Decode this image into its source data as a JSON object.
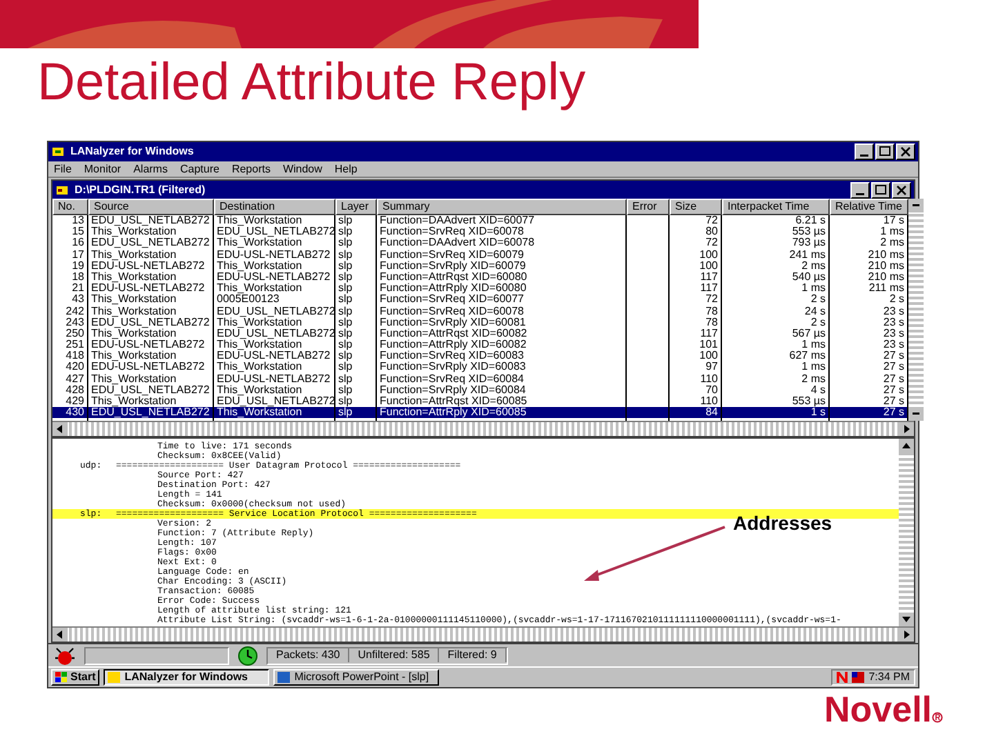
{
  "slide": {
    "title": "Detailed Attribute Reply",
    "logo": "Novell",
    "annotation": "Addresses"
  },
  "window": {
    "title": "LANalyzer for Windows"
  },
  "menu": [
    "File",
    "Monitor",
    "Alarms",
    "Capture",
    "Reports",
    "Window",
    "Help"
  ],
  "child_window": {
    "title": "D:\\PLDGIN.TR1 (Filtered)"
  },
  "table": {
    "columns": [
      "No.",
      "Source",
      "Destination",
      "Layer",
      "Summary",
      "Error",
      "Size",
      "Interpacket Time",
      "Relative Time"
    ],
    "rows": [
      {
        "selected": false,
        "cells": [
          "13",
          "EDU_USL_NETLAB272",
          "This_Workstation",
          "slp",
          "Function=DAAdvert XID=60077",
          "",
          "72",
          "6.21 s",
          "17 s"
        ]
      },
      {
        "selected": false,
        "cells": [
          "15",
          "This_Workstation",
          "EDU_USL_NETLAB272",
          "slp",
          "Function=SrvReq XID=60078",
          "",
          "80",
          "553 µs",
          "1 ms"
        ]
      },
      {
        "selected": false,
        "cells": [
          "16",
          "EDU_USL_NETLAB272",
          "This_Workstation",
          "slp",
          "Function=DAAdvert XID=60078",
          "",
          "72",
          "793 µs",
          "2 ms"
        ]
      },
      {
        "selected": false,
        "cells": [
          "17",
          "This_Workstation",
          "EDU-USL-NETLAB272",
          "slp",
          "Function=SrvReq XID=60079",
          "",
          "100",
          "241 ms",
          "210 ms"
        ]
      },
      {
        "selected": false,
        "cells": [
          "19",
          "EDU-USL-NETLAB272",
          "This_Workstation",
          "slp",
          "Function=SrvRply XID=60079",
          "",
          "100",
          "2 ms",
          "210 ms"
        ]
      },
      {
        "selected": false,
        "cells": [
          "18",
          "This_Workstation",
          "EDU-USL-NETLAB272",
          "slp",
          "Function=AttrRqst XID=60080",
          "",
          "117",
          "540 µs",
          "210 ms"
        ]
      },
      {
        "selected": false,
        "cells": [
          "21",
          "EDU-USL-NETLAB272",
          "This_Workstation",
          "slp",
          "Function=AttrRply XID=60080",
          "",
          "117",
          "1 ms",
          "211 ms"
        ]
      },
      {
        "selected": false,
        "cells": [
          "43",
          "This_Workstation",
          "0005E00123",
          "slp",
          "Function=SrvReq XID=60077",
          "",
          "72",
          "2 s",
          "2 s"
        ]
      },
      {
        "selected": false,
        "cells": [
          "242",
          "This_Workstation",
          "EDU_USL_NETLAB272",
          "slp",
          "Function=SrvReq XID=60078",
          "",
          "78",
          "24 s",
          "23 s"
        ]
      },
      {
        "selected": false,
        "cells": [
          "243",
          "EDU_USL_NETLAB272",
          "This_Workstation",
          "slp",
          "Function=SrvRply XID=60081",
          "",
          "78",
          "2 s",
          "23 s"
        ]
      },
      {
        "selected": false,
        "cells": [
          "250",
          "This_Workstation",
          "EDU_USL_NETLAB272",
          "slp",
          "Function=AttrRqst XID=60082",
          "",
          "117",
          "567 µs",
          "23 s"
        ]
      },
      {
        "selected": false,
        "cells": [
          "251",
          "EDU-USL-NETLAB272",
          "This_Workstation",
          "slp",
          "Function=AttrRply XID=60082",
          "",
          "101",
          "1 ms",
          "23 s"
        ]
      },
      {
        "selected": false,
        "cells": [
          "418",
          "This_Workstation",
          "EDU-USL-NETLAB272",
          "slp",
          "Function=SrvReq XID=60083",
          "",
          "100",
          "627 ms",
          "27 s"
        ]
      },
      {
        "selected": false,
        "cells": [
          "420",
          "EDU-USL-NETLAB272",
          "This_Workstation",
          "slp",
          "Function=SrvRply XID=60083",
          "",
          "97",
          "1 ms",
          "27 s"
        ]
      },
      {
        "selected": false,
        "cells": [
          "427",
          "This_Workstation",
          "EDU-USL-NETLAB272",
          "slp",
          "Function=SrvReq XID=60084",
          "",
          "110",
          "2 ms",
          "27 s"
        ]
      },
      {
        "selected": false,
        "cells": [
          "428",
          "EDU_USL_NETLAB272",
          "This_Workstation",
          "slp",
          "Function=SrvRply XID=60084",
          "",
          "70",
          "4 s",
          "27 s"
        ]
      },
      {
        "selected": false,
        "cells": [
          "429",
          "This_Workstation",
          "EDU_USL_NETLAB272",
          "slp",
          "Function=AttrRqst XID=60085",
          "",
          "110",
          "553 µs",
          "27 s"
        ]
      },
      {
        "selected": true,
        "cells": [
          "430",
          "EDU_USL_NETLAB272",
          "This_Workstation",
          "slp",
          "Function=AttrRply XID=60085",
          "",
          "84",
          "1 s",
          "27 s"
        ]
      }
    ]
  },
  "details": [
    {
      "text": "Time to live: 171 seconds",
      "highlighted": false
    },
    {
      "text": "Checksum: 0x8CEE(Valid)",
      "highlighted": false
    },
    {
      "prefix": "udp:",
      "text": "==================== User Datagram Protocol ====================",
      "highlighted": false
    },
    {
      "text": "Source Port: 427",
      "highlighted": false
    },
    {
      "text": "Destination Port: 427",
      "highlighted": false
    },
    {
      "text": "Length = 141",
      "highlighted": false
    },
    {
      "text": "Checksum: 0x0000(checksum not used)",
      "highlighted": false
    },
    {
      "prefix": "slp:",
      "text": "==================== Service Location Protocol ====================",
      "highlighted": true
    },
    {
      "text": "Version: 2",
      "highlighted": false
    },
    {
      "text": "Function: 7 (Attribute Reply)",
      "highlighted": false
    },
    {
      "text": "Length: 107",
      "highlighted": false
    },
    {
      "text": "Flags: 0x00",
      "highlighted": false
    },
    {
      "text": "Next Ext: 0",
      "highlighted": false
    },
    {
      "text": "Language Code: en",
      "highlighted": false
    },
    {
      "text": "Char Encoding: 3 (ASCII)",
      "highlighted": false
    },
    {
      "text": "Transaction: 60085",
      "highlighted": false
    },
    {
      "text": "Error Code: Success",
      "highlighted": false
    },
    {
      "text": "Length of attribute list string: 121",
      "highlighted": false
    },
    {
      "text": "Attribute List String: (svcaddr-ws=1-6-1-2a-01000000111145110000),(svcaddr-ws=1-17-1711670210111111110000001111),(svcaddr-ws=1-",
      "highlighted": false
    }
  ],
  "status_bar": [
    "Packets: 430",
    "Unfiltered: 585",
    "Filtered: 9"
  ],
  "taskbar": {
    "start": "Start",
    "items": [
      {
        "label": "LANalyzer for Windows",
        "selected": true
      },
      {
        "label": "Microsoft PowerPoint - [slp]",
        "selected": false
      }
    ],
    "clock": "7:34 PM"
  }
}
